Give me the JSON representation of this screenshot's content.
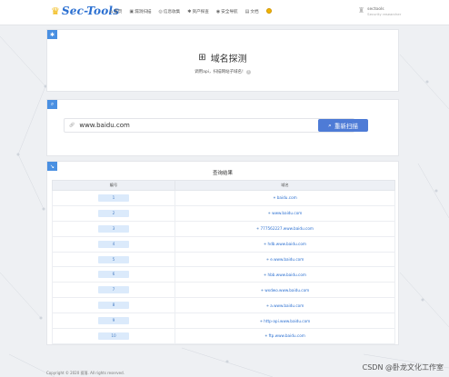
{
  "logo": {
    "text": "Sec-Tools"
  },
  "nav": [
    {
      "icon": "home-icon",
      "glyph": "⌂",
      "label": "首页"
    },
    {
      "icon": "toolbox-icon",
      "glyph": "▣",
      "label": "漏洞扫描"
    },
    {
      "icon": "globe-icon",
      "glyph": "◎",
      "label": "信息收集"
    },
    {
      "icon": "gear-icon",
      "glyph": "✱",
      "label": "资产探查"
    },
    {
      "icon": "shield-icon",
      "glyph": "◉",
      "label": "安全导航"
    },
    {
      "icon": "doc-icon",
      "glyph": "▤",
      "label": "文档"
    }
  ],
  "user": {
    "name": "sectools",
    "role": "Security researcher"
  },
  "header_card": {
    "title": "域名探测",
    "subtitle": "调用api，扫描网站子域名!",
    "help": "?"
  },
  "search": {
    "value": "www.baidu.com",
    "button": "重新扫描"
  },
  "results": {
    "title": "查询结果",
    "columns": [
      "编号",
      "域名"
    ],
    "rows": [
      {
        "id": "1",
        "domain": "baidu.com"
      },
      {
        "id": "2",
        "domain": "www.baidu.com"
      },
      {
        "id": "3",
        "domain": "777562227.www.baidu.com"
      },
      {
        "id": "4",
        "domain": "hdb.www.baidu.com"
      },
      {
        "id": "5",
        "domain": "e.www.baidu.com"
      },
      {
        "id": "6",
        "domain": "hbb.www.baidu.com"
      },
      {
        "id": "7",
        "domain": "wxdwo.www.baidu.com"
      },
      {
        "id": "8",
        "domain": "a.www.baidu.com"
      },
      {
        "id": "9",
        "domain": "http-api.www.baidu.com"
      },
      {
        "id": "10",
        "domain": "ftp.www.baidu.com"
      }
    ]
  },
  "footer": "Copyright © 2020 孤落. All rights reserved.",
  "watermark": "CSDN @卧龙文化工作室",
  "colors": {
    "accent": "#4e7bd6",
    "brand": "#2a6fd1",
    "tag": "#4a90e2"
  }
}
